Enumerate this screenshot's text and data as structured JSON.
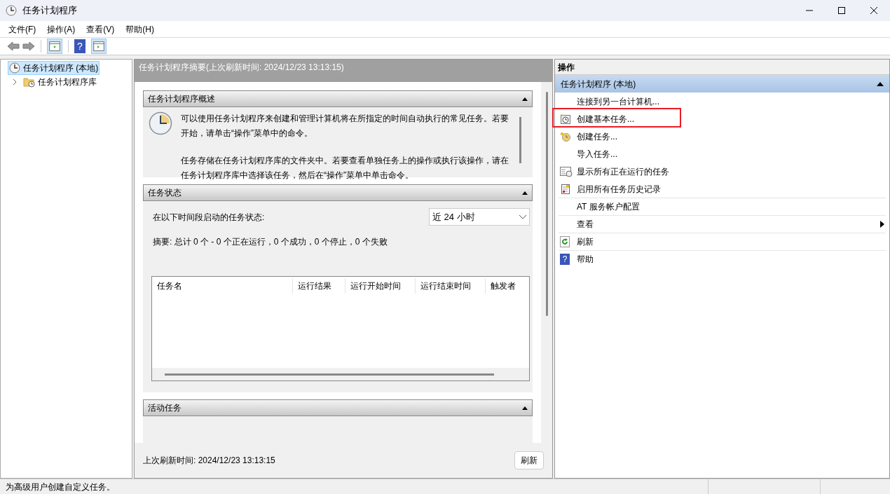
{
  "window": {
    "title": "任务计划程序"
  },
  "menu": [
    "文件(F)",
    "操作(A)",
    "查看(V)",
    "帮助(H)"
  ],
  "toolbar": {
    "help_glyph": "?"
  },
  "tree": [
    {
      "label": "任务计划程序 (本地)",
      "selected": true,
      "children": [
        {
          "label": "任务计划程序库",
          "selected": false,
          "expanded": false
        }
      ]
    }
  ],
  "summary": {
    "header": "任务计划程序摘要(上次刷新时间: 2024/12/23 13:13:15)",
    "sections": [
      {
        "kind": "overview",
        "title": "任务计划程序概述",
        "expanded": true,
        "paragraphs": [
          "可以使用任务计划程序来创建和管理计算机将在所指定的时间自动执行的常见任务。若要开始，请单击“操作”菜单中的命令。",
          "任务存储在任务计划程序库的文件夹中。若要查看单独任务上的操作或执行该操作，请在任务计划程序库中选择该任务，然后在“操作”菜单中单击命令。"
        ]
      },
      {
        "kind": "status",
        "title": "任务状态",
        "expanded": true,
        "period_label": "在以下时间段启动的任务状态:",
        "period": "近 24 小时",
        "summary": "摘要: 总计 0 个 - 0 个正在运行，0 个成功，0 个停止，0 个失败",
        "columns": [
          "任务名",
          "运行结果",
          "运行开始时间",
          "运行结束时间",
          "触发者"
        ]
      },
      {
        "kind": "active",
        "title": "活动任务",
        "expanded": true
      }
    ],
    "last_refresh": "上次刷新时间: 2024/12/23 13:13:15",
    "refresh_button": "刷新"
  },
  "actions": {
    "title": "操作",
    "group": "任务计划程序 (本地)",
    "expanded": true,
    "items": [
      {
        "label": "连接到另一台计算机...",
        "kind": "plain",
        "highlighted": false,
        "divider": false,
        "submenu": false
      },
      {
        "label": "创建基本任务...",
        "kind": "wizard",
        "highlighted": true,
        "divider": false,
        "submenu": false
      },
      {
        "label": "创建任务...",
        "kind": "task",
        "highlighted": false,
        "divider": false,
        "submenu": false
      },
      {
        "label": "导入任务...",
        "kind": "plain",
        "highlighted": false,
        "divider": false,
        "submenu": false
      },
      {
        "label": "显示所有正在运行的任务",
        "kind": "running",
        "highlighted": false,
        "divider": false,
        "submenu": false
      },
      {
        "label": "启用所有任务历史记录",
        "kind": "log",
        "highlighted": false,
        "divider": false,
        "submenu": false
      },
      {
        "label": "AT 服务帐户配置",
        "kind": "plain",
        "highlighted": false,
        "divider": true,
        "submenu": false
      },
      {
        "label": "查看",
        "kind": "plain",
        "highlighted": false,
        "divider": true,
        "submenu": true
      },
      {
        "label": "刷新",
        "kind": "refresh",
        "highlighted": false,
        "divider": true,
        "submenu": false
      },
      {
        "label": "帮助",
        "kind": "help",
        "glyph": "?",
        "highlighted": false,
        "divider": true,
        "submenu": false
      }
    ]
  },
  "status_bar": "为高级用户创建自定义任务。"
}
